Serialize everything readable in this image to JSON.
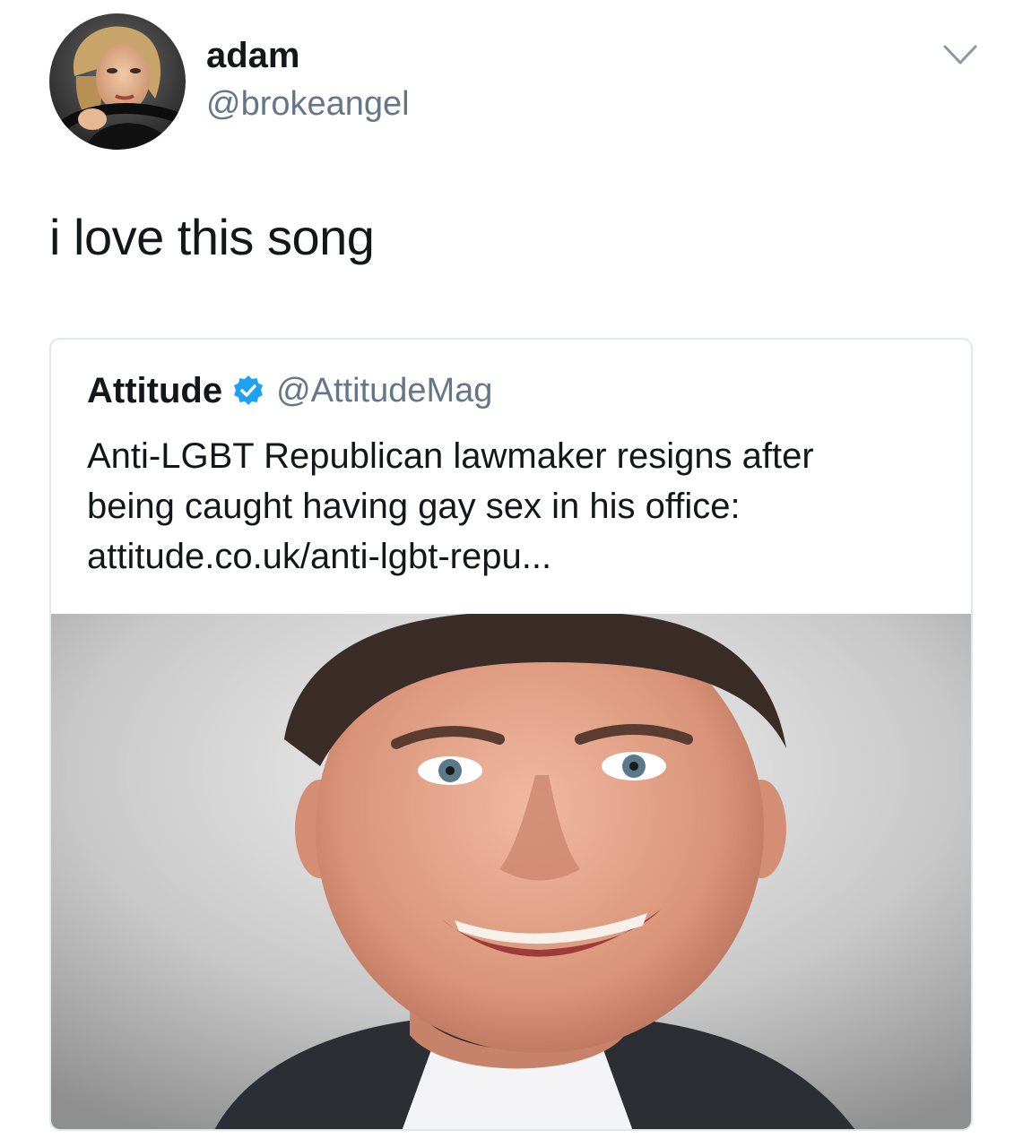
{
  "tweet": {
    "author": {
      "name": "adam",
      "handle": "@brokeangel"
    },
    "text": "i love this song",
    "quoted": {
      "author": {
        "name": "Attitude",
        "handle": "@AttitudeMag",
        "verified": true
      },
      "text_lines": [
        "Anti-LGBT Republican lawmaker resigns after",
        "being caught having gay sex in his office:",
        "attitude.co.uk/anti-lgbt-repu..."
      ]
    }
  },
  "icons": {
    "caret": "chevron-down-icon",
    "verified": "verified-badge-icon"
  },
  "colors": {
    "text_primary": "#14171a",
    "text_secondary": "#657786",
    "verified_blue": "#1da1f2",
    "card_border": "#e1e8ed"
  }
}
